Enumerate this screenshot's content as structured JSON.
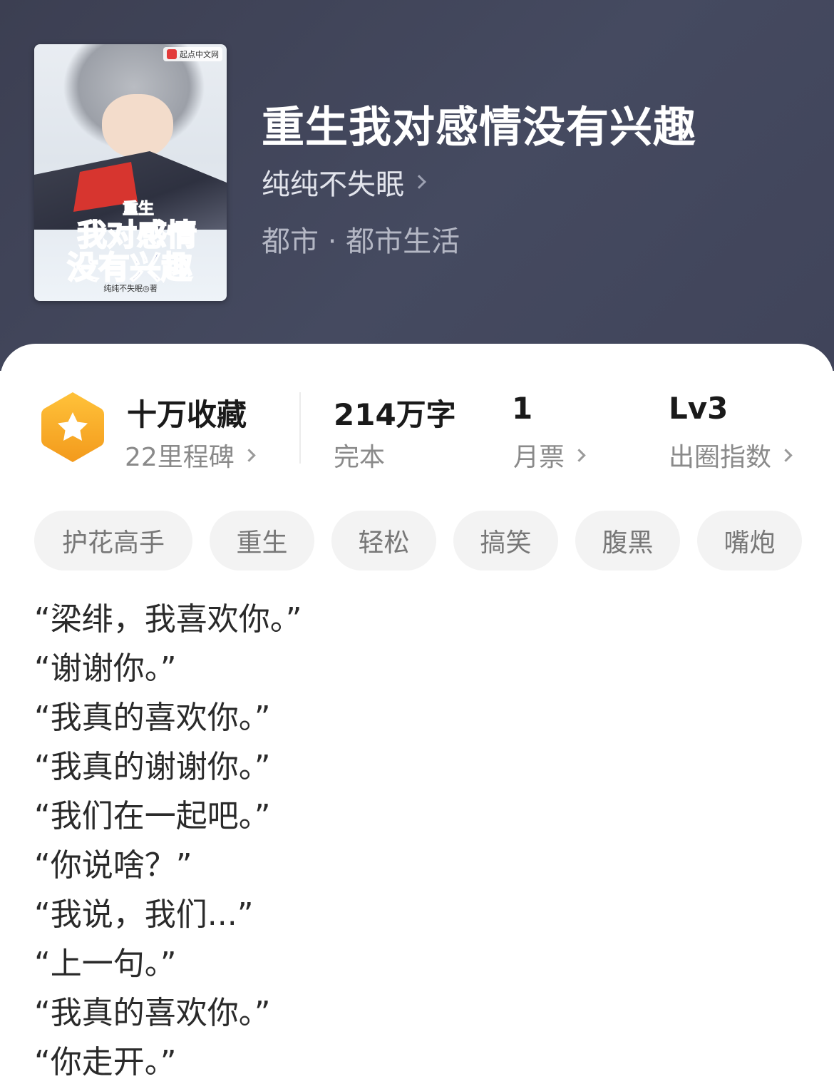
{
  "book": {
    "title": "重生我对感情没有兴趣",
    "author": "纯纯不失眠",
    "category": "都市 · 都市生活"
  },
  "cover": {
    "platform_logo_text": "起点中文网",
    "art_title_line1": "重生",
    "art_title_line2": "我对感情",
    "art_title_line3": "没有兴趣",
    "author_credit": "纯纯不失眠◎著"
  },
  "stats": {
    "collection": {
      "main": "十万收藏",
      "sub": "22里程碑"
    },
    "words": {
      "main": "214万字",
      "sub": "完本"
    },
    "monthly_ticket": {
      "main": "1",
      "sub": "月票"
    },
    "popularity": {
      "main": "Lv3",
      "sub": "出圈指数"
    }
  },
  "tags": [
    "护花高手",
    "重生",
    "轻松",
    "搞笑",
    "腹黑",
    "嘴炮"
  ],
  "description_lines": [
    "“梁绯，我喜欢你。”",
    "“谢谢你。”",
    "“我真的喜欢你。”",
    "“我真的谢谢你。”",
    "“我们在一起吧。”",
    "“你说啥？”",
    "“我说，我们...”",
    "“上一句。”",
    "“我真的喜欢你。”",
    "“你走开。”"
  ],
  "colors": {
    "header_bg": "#41455a",
    "medal_orange": "#f5a623",
    "tag_bg": "#f3f3f3"
  },
  "icons": {
    "author_arrow": "chevron-right-icon",
    "medal": "star-hexagon-medal-icon"
  }
}
